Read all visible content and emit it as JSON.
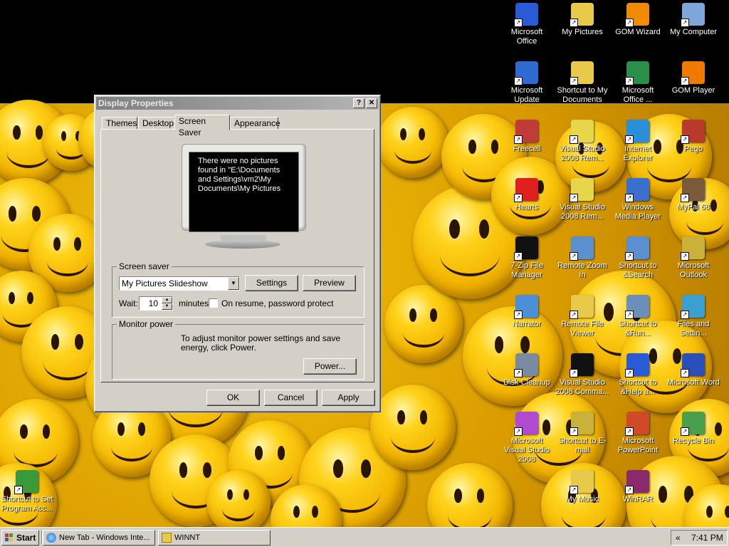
{
  "desktop_icons": [
    {
      "id": "microsoft-office",
      "label": "Microsoft Office",
      "icon": "office-icon",
      "color": "#2a5bd7"
    },
    {
      "id": "my-pictures",
      "label": "My Pictures",
      "icon": "pictures-folder-icon",
      "color": "#e9c94a"
    },
    {
      "id": "gom-wizard",
      "label": "GOM Wizard",
      "icon": "gom-wizard-icon",
      "color": "#f08a00"
    },
    {
      "id": "my-computer",
      "label": "My Computer",
      "icon": "computer-icon",
      "color": "#7fa6d8"
    },
    {
      "id": "microsoft-update",
      "label": "Microsoft Update",
      "icon": "update-icon",
      "color": "#2f6ad0"
    },
    {
      "id": "shortcut-my-documents",
      "label": "Shortcut to My Documents",
      "icon": "documents-folder-icon",
      "color": "#e9c94a"
    },
    {
      "id": "microsoft-office-2",
      "label": "Microsoft Office ...",
      "icon": "office-tools-icon",
      "color": "#2a8f4a"
    },
    {
      "id": "gom-player",
      "label": "GOM Player",
      "icon": "gom-player-icon",
      "color": "#f07a00"
    },
    {
      "id": "freecell",
      "label": "Freecell",
      "icon": "freecell-icon",
      "color": "#c23b3b"
    },
    {
      "id": "visual-studio-rem-1",
      "label": "Visual Studio 2008 Rem...",
      "icon": "visual-studio-icon",
      "color": "#e7d54a"
    },
    {
      "id": "internet-explorer",
      "label": "Internet Explorer",
      "icon": "internet-explorer-icon",
      "color": "#2a8fd8"
    },
    {
      "id": "pego",
      "label": "Pego",
      "icon": "pego-icon",
      "color": "#b83a2a"
    },
    {
      "id": "hearts",
      "label": "Hearts",
      "icon": "hearts-icon",
      "color": "#e02020"
    },
    {
      "id": "visual-studio-rem-2",
      "label": "Visual Studio 2008 Rem...",
      "icon": "visual-studio-icon",
      "color": "#e7d54a"
    },
    {
      "id": "windows-media-player",
      "label": "Windows Media Player",
      "icon": "media-player-icon",
      "color": "#3a6fd0"
    },
    {
      "id": "mypal",
      "label": "MyPal 68",
      "icon": "mypal-icon",
      "color": "#7a5a3a"
    },
    {
      "id": "7zip",
      "label": "7-Zip File Manager",
      "icon": "7zip-icon",
      "color": "#111111"
    },
    {
      "id": "remote-zoom",
      "label": "Remote Zoom In",
      "icon": "remote-zoom-icon",
      "color": "#5a8fd0"
    },
    {
      "id": "shortcut-search",
      "label": "Shortcut to &Search",
      "icon": "search-icon",
      "color": "#5a8fd0"
    },
    {
      "id": "microsoft-outlook",
      "label": "Microsoft Outlook",
      "icon": "outlook-icon",
      "color": "#c9b13a"
    },
    {
      "id": "narrator",
      "label": "Narrator",
      "icon": "narrator-icon",
      "color": "#4a8fd8"
    },
    {
      "id": "remote-file-viewer",
      "label": "Remote File Viewer",
      "icon": "file-viewer-icon",
      "color": "#e9c94a"
    },
    {
      "id": "shortcut-run",
      "label": "Shortcut to &Run...",
      "icon": "run-icon",
      "color": "#6a8fb8"
    },
    {
      "id": "files-settings",
      "label": "Files and Settin...",
      "icon": "transfer-icon",
      "color": "#3aa0d0"
    },
    {
      "id": "disk-cleanup",
      "label": "Disk Cleanup",
      "icon": "disk-cleanup-icon",
      "color": "#7a8aa0"
    },
    {
      "id": "visual-studio-command",
      "label": "Visual Studio 2008 Comma...",
      "icon": "command-prompt-icon",
      "color": "#111111"
    },
    {
      "id": "shortcut-help",
      "label": "Shortcut to &Help a...",
      "icon": "help-icon",
      "color": "#2a5bd7"
    },
    {
      "id": "microsoft-word",
      "label": "Microsoft Word",
      "icon": "word-icon",
      "color": "#2a4fb8"
    },
    {
      "id": "ms-visual-studio",
      "label": "Microsoft Visual Studio 2008",
      "icon": "visual-studio-2008-icon",
      "color": "#b04ad0"
    },
    {
      "id": "shortcut-email",
      "label": "Shortcut to E-mail",
      "icon": "email-icon",
      "color": "#c9b13a"
    },
    {
      "id": "microsoft-powerpoint",
      "label": "Microsoft PowerPoint",
      "icon": "powerpoint-icon",
      "color": "#d04a2a"
    },
    {
      "id": "recycle-bin",
      "label": "Recycle Bin",
      "icon": "recycle-bin-icon",
      "color": "#4aa04a"
    },
    {
      "id": "set-program-access",
      "label": "Shortcut to Set Program Acc...",
      "icon": "program-access-icon",
      "color": "#3a9a3a"
    },
    {
      "id": "my-music",
      "label": "My Music",
      "icon": "music-folder-icon",
      "color": "#e9c94a"
    },
    {
      "id": "winrar",
      "label": "WinRAR",
      "icon": "winrar-icon",
      "color": "#8a2a6a"
    }
  ],
  "dialog": {
    "title": "Display Properties",
    "help_btn": "?",
    "close_btn": "✕",
    "tabs": [
      "Themes",
      "Desktop",
      "Screen Saver",
      "Appearance"
    ],
    "active_tab": "Screen Saver",
    "preview_text": "There were no pictures found in \"E:\\Documents and Settings\\vm2\\My Documents\\My Pictures",
    "screensaver": {
      "group_label": "Screen saver",
      "selected": "My Pictures Slideshow",
      "settings_label": "Settings",
      "preview_label": "Preview",
      "wait_label": "Wait:",
      "wait_value": "10",
      "minutes_label": "minutes",
      "resume_label": "On resume, password protect",
      "resume_checked": false
    },
    "monitor_power": {
      "group_label": "Monitor power",
      "description": "To adjust monitor power settings and save energy, click Power.",
      "power_label": "Power..."
    },
    "ok_label": "OK",
    "cancel_label": "Cancel",
    "apply_label": "Apply"
  },
  "taskbar": {
    "start_label": "Start",
    "tasks": [
      {
        "label": "New Tab - Windows Inte...",
        "icon": "internet-explorer-icon"
      },
      {
        "label": "WINNT",
        "icon": "folder-icon"
      }
    ],
    "tray_chevron": "«",
    "clock": "7:41 PM"
  }
}
